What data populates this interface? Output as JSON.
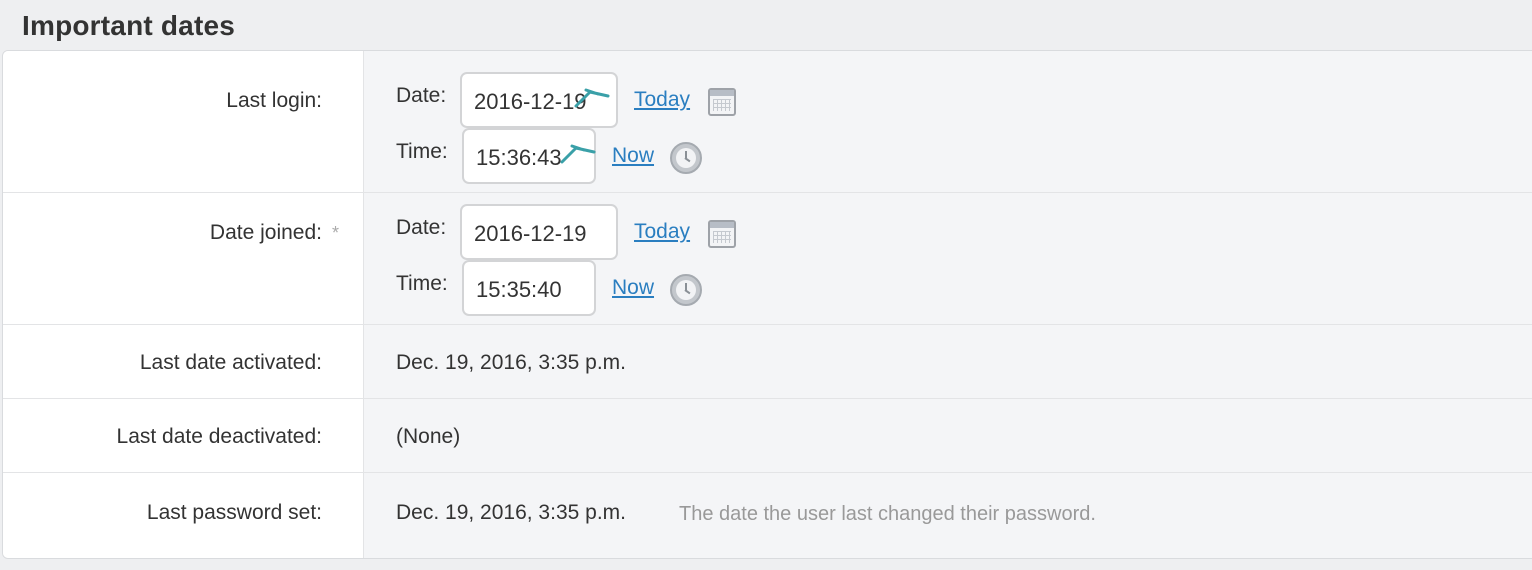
{
  "section_title": "Important dates",
  "rows": {
    "last_login": {
      "label": "Last login:",
      "date_label": "Date:",
      "date_value": "2016-12-19",
      "today_link": "Today",
      "time_label": "Time:",
      "time_value": "15:36:43",
      "now_link": "Now"
    },
    "date_joined": {
      "label": "Date joined:",
      "required_marker": "*",
      "date_label": "Date:",
      "date_value": "2016-12-19",
      "today_link": "Today",
      "time_label": "Time:",
      "time_value": "15:35:40",
      "now_link": "Now"
    },
    "last_date_activated": {
      "label": "Last date activated:",
      "value": "Dec. 19, 2016, 3:35 p.m."
    },
    "last_date_deactivated": {
      "label": "Last date deactivated:",
      "value": "(None)"
    },
    "last_password_set": {
      "label": "Last password set:",
      "value": "Dec. 19, 2016, 3:35 p.m.",
      "help_text": "The date the user last changed their password."
    }
  },
  "icons": {
    "calendar": "calendar-icon",
    "clock": "clock-icon",
    "autofill_mark": "autofill-key-icon"
  },
  "colors": {
    "link": "#2a7ec0",
    "help_text": "#999999",
    "label_background": "#ffffff",
    "value_background": "#f4f5f7"
  }
}
